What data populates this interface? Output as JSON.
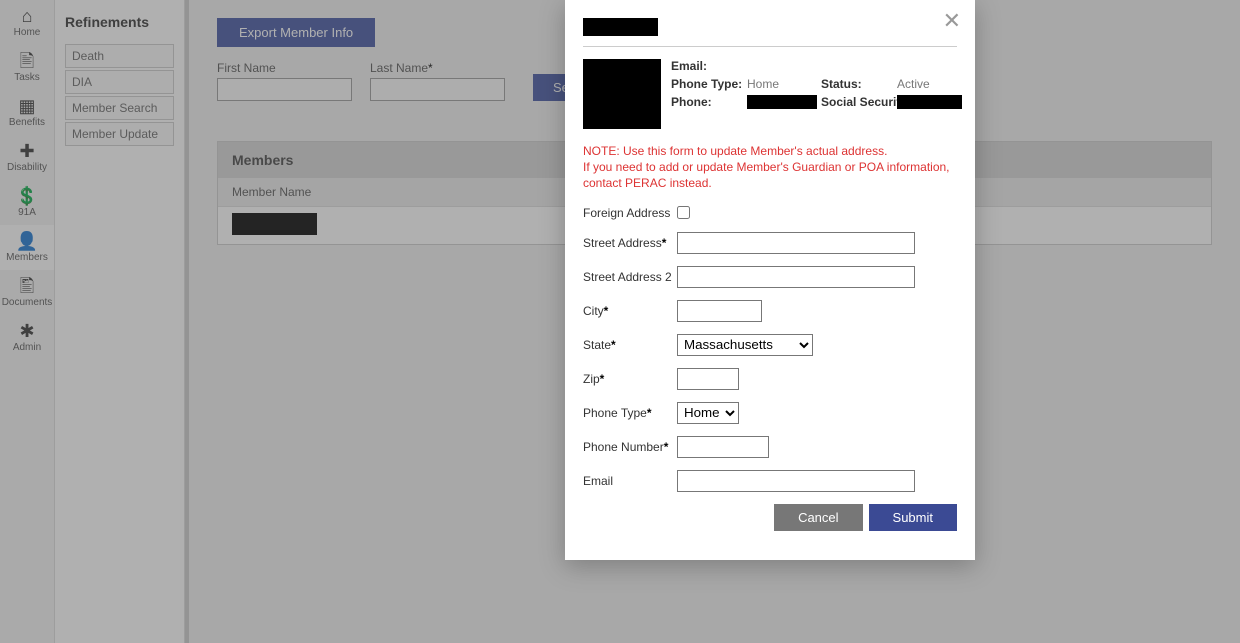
{
  "nav": {
    "items": [
      {
        "icon": "⌂",
        "label": "Home"
      },
      {
        "icon": "🖹",
        "label": "Tasks"
      },
      {
        "icon": "▦",
        "label": "Benefits"
      },
      {
        "icon": "✚",
        "label": "Disability"
      },
      {
        "icon": "💲",
        "label": "91A"
      },
      {
        "icon": "👤",
        "label": "Members"
      },
      {
        "icon": "🖺",
        "label": "Documents"
      },
      {
        "icon": "✱",
        "label": "Admin"
      }
    ],
    "active_index": 5
  },
  "refinements": {
    "title": "Refinements",
    "items": [
      "Death",
      "DIA",
      "Member Search",
      "Member Update"
    ]
  },
  "main": {
    "export_label": "Export Member Info",
    "first_name_label": "First Name",
    "last_name_label": "Last Name",
    "search_label": "Search",
    "members_title": "Members",
    "column_member_name": "Member Name"
  },
  "modal": {
    "info": {
      "email_label": "Email:",
      "email_value": "",
      "phone_type_label": "Phone Type:",
      "phone_type_value": "Home",
      "status_label": "Status:",
      "status_value": "Active",
      "phone_label": "Phone:",
      "ssn_label": "Social Security:"
    },
    "note_line1": "NOTE: Use this form to update Member's actual address.",
    "note_line2": "If you need to add or update Member's Guardian or POA information, contact PERAC instead.",
    "fields": {
      "foreign_address": "Foreign Address",
      "street_address": "Street Address",
      "street_address2": "Street Address 2",
      "city": "City",
      "state": "State",
      "state_value": "Massachusetts",
      "zip": "Zip",
      "phone_type": "Phone Type",
      "phone_type_value": "Home",
      "phone_number": "Phone Number",
      "email": "Email"
    },
    "cancel_label": "Cancel",
    "submit_label": "Submit"
  }
}
